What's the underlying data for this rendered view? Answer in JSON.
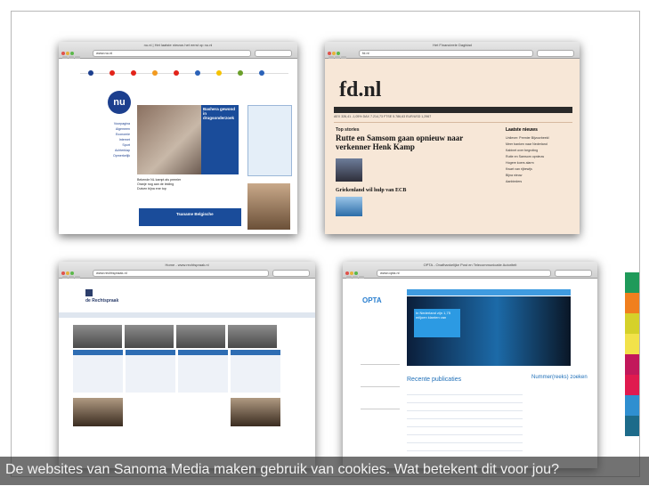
{
  "cookie_bar": {
    "text": "De websites van Sanoma Media maken gebruik van cookies. Wat betekent dit voor jou?"
  },
  "accent_colors": [
    "#1f9a5a",
    "#f07f1e",
    "#d5d12a",
    "#f2e24a",
    "#c2185b",
    "#e01a4f",
    "#2f8fd0",
    "#1d6b8a"
  ],
  "screenshots": [
    {
      "id": "nu",
      "window_title": "nu.nl | Het laatste nieuws het eerst op nu.nl",
      "url": "www.nu.nl",
      "logo": "nu",
      "hero_headline": "Bashera gewond in drugsonderzoek",
      "side_links": [
        "Voorpagina",
        "Algemeen",
        "Economie",
        "Internet",
        "Sport",
        "Achterklap",
        "Opmerkelijk"
      ],
      "list_items": [
        "Bekende NL kampt als premier",
        "Oranje nog aan de leiding",
        "Duiven bijna ene top"
      ],
      "ad_title": "Tsaname Belgische"
    },
    {
      "id": "fd",
      "window_title": "Het Financieele Dagblad",
      "url": "fd.nl",
      "logo": "fd.nl",
      "section": "Top stories",
      "headline_1": "Rutte en Samsom gaan opnieuw naar verkenner Henk Kamp",
      "headline_2": "Griekenland wil hulp van ECB",
      "sidebar_title": "Laatste nieuws",
      "ticker": "AEX 326,41 -1,05%   DAX 7.214,73   FTSE 5.786,63   EUR/USD 1,2967",
      "sidebar_items": [
        "Unilever: Premier Bijvoorbeeld",
        "Meer banken naar Nederland",
        "Kabinet over begroting",
        "Rutte en Samsom opnieuw",
        "Hogere koers alarm",
        "Kwart van rijbewijs",
        "Bijna nieuw",
        "Aanbieders"
      ]
    },
    {
      "id": "rechtspraak",
      "window_title": "Home - www.rechtspraak.nl",
      "url": "www.rechtspraak.nl",
      "logo": "de Rechtspraak"
    },
    {
      "id": "opta",
      "window_title": "OPTA - Onafhankelijke Post en Telecommunicatie Autoriteit",
      "url": "www.opta.nl",
      "logo": "OPTA",
      "banner_text": "In Nederland zijn 1,75 miljoen klanten van",
      "recent_title": "Recente publicaties",
      "number_title": "Nummer(reeks) zoeken"
    }
  ]
}
